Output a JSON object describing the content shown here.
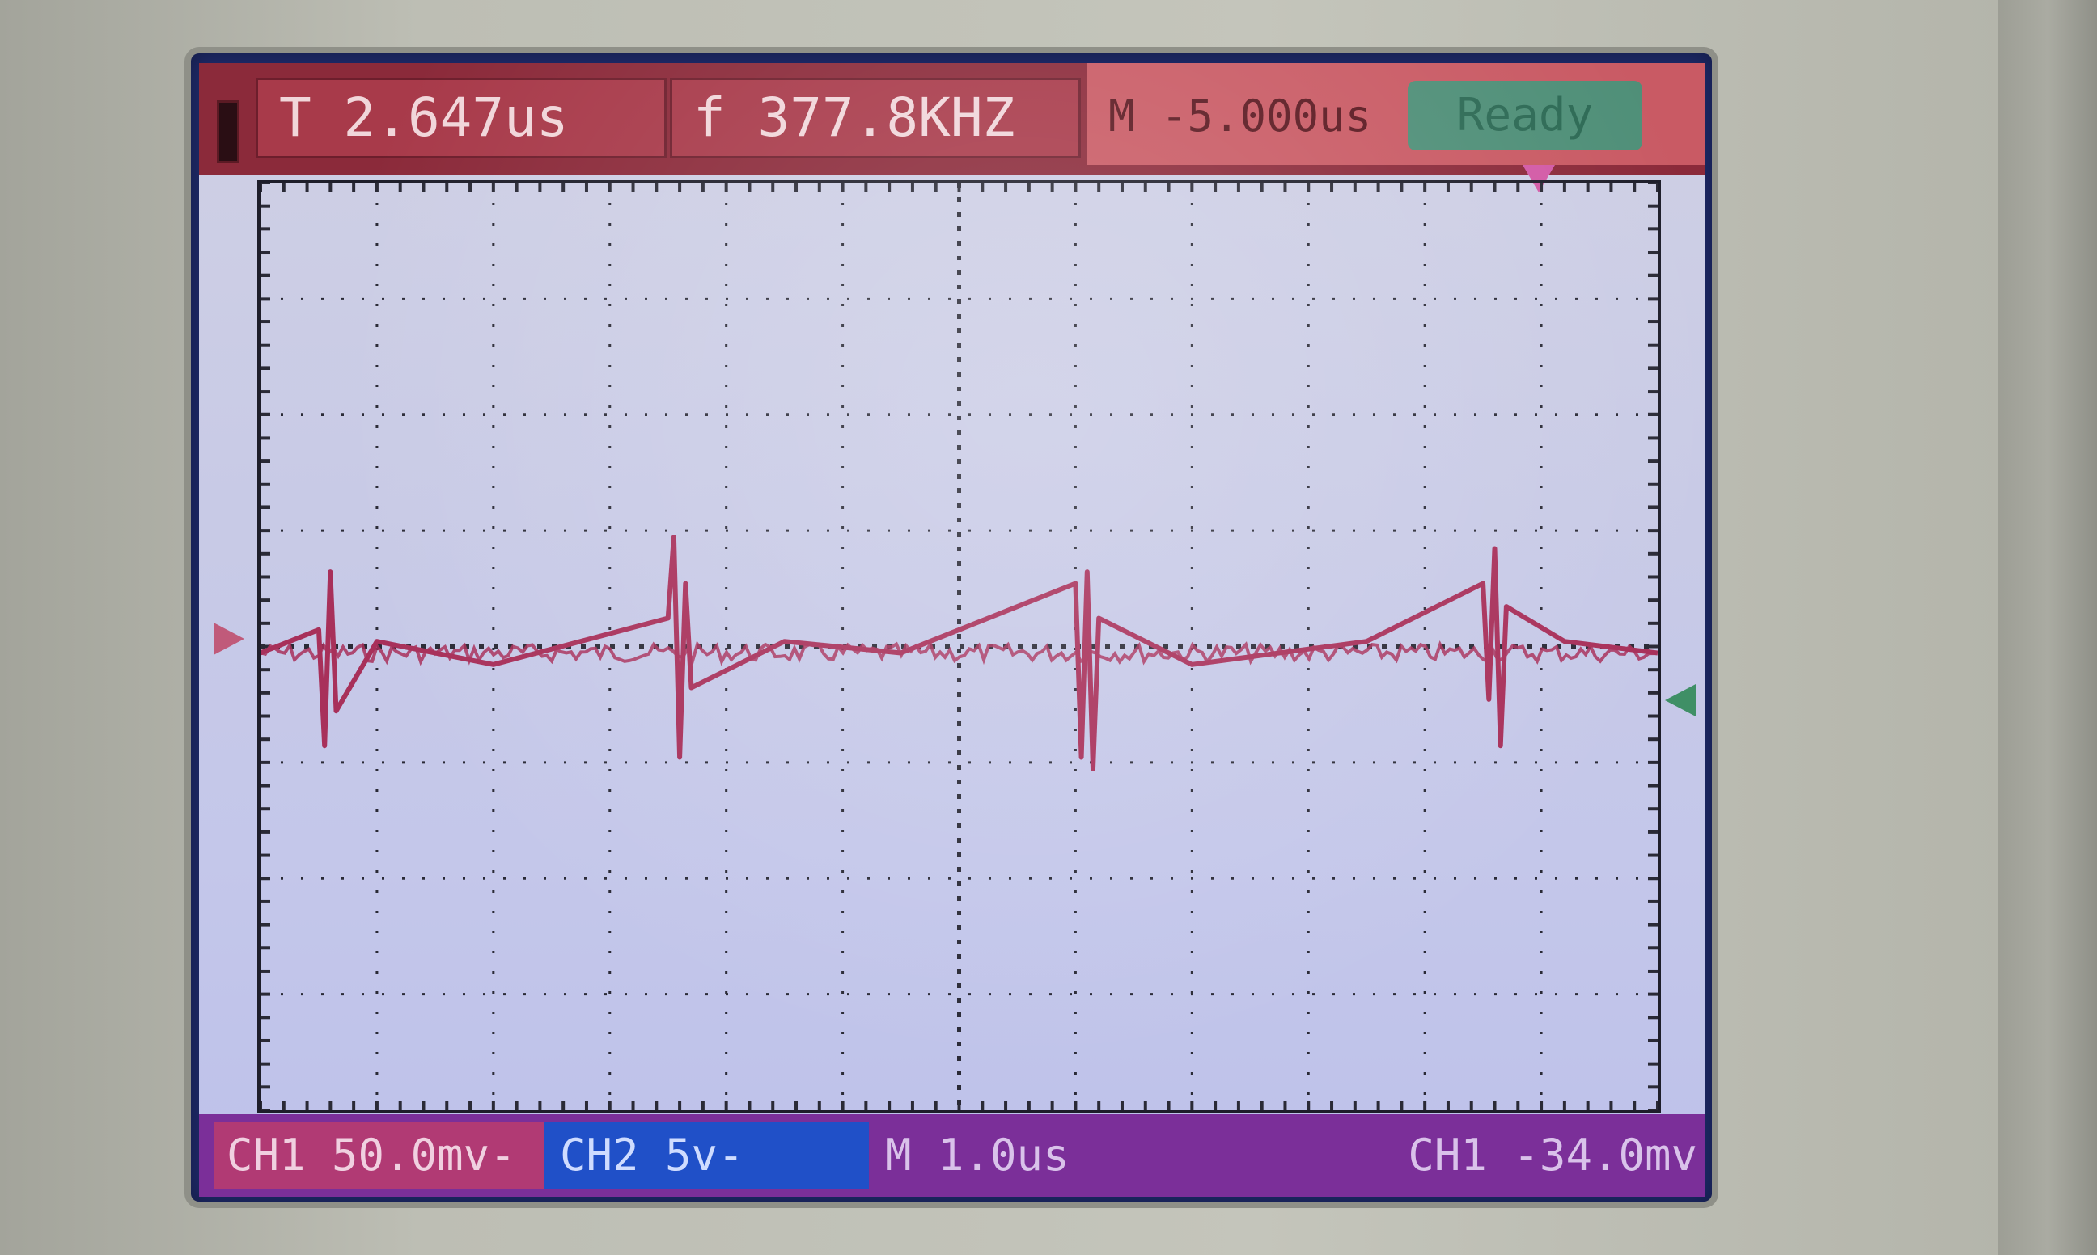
{
  "header": {
    "period": "T 2.647us",
    "frequency": "f 377.8KHZ",
    "main_timebase": "M -5.000us",
    "status": "Ready"
  },
  "footer": {
    "ch1_scale": "CH1 50.0mv-",
    "ch2_scale": "CH2 5v-",
    "timebase": "M 1.0us",
    "trigger": "CH1 -34.0mv"
  },
  "colors": {
    "header_bar": "#8b2a3a",
    "status_ready": "#4f8f78",
    "ch1_trace": "#a8305a",
    "ch2_badge": "#2050c8",
    "footer_bar": "#7b2f99",
    "screen_bg": "#c8cae6"
  },
  "icons": {
    "battery": "battery-icon",
    "trigger_position": "trigger-position-marker-icon",
    "ch1_ground": "ch1-ground-marker-icon",
    "ch2_ground": "ch2-ground-marker-icon"
  },
  "chart_data": {
    "type": "line",
    "grid": true,
    "series": [
      {
        "name": "CH1",
        "x": [
          0,
          0.5,
          0.55,
          0.6,
          0.65,
          1.0,
          2.0,
          3.5,
          3.55,
          3.6,
          3.65,
          3.7,
          4.5,
          5.5,
          7.0,
          7.05,
          7.1,
          7.15,
          7.2,
          8.0,
          9.5,
          10.5,
          10.55,
          10.6,
          10.65,
          10.7,
          11.2,
          12.0
        ],
        "values": [
          0,
          0.2,
          -0.8,
          0.7,
          -0.5,
          0.1,
          -0.1,
          0.3,
          1.0,
          -0.9,
          0.6,
          -0.3,
          0.1,
          0.0,
          0.6,
          -0.9,
          0.7,
          -1.0,
          0.3,
          -0.1,
          0.1,
          0.6,
          -0.4,
          0.9,
          -0.8,
          0.4,
          0.1,
          0.0
        ]
      }
    ]
  }
}
